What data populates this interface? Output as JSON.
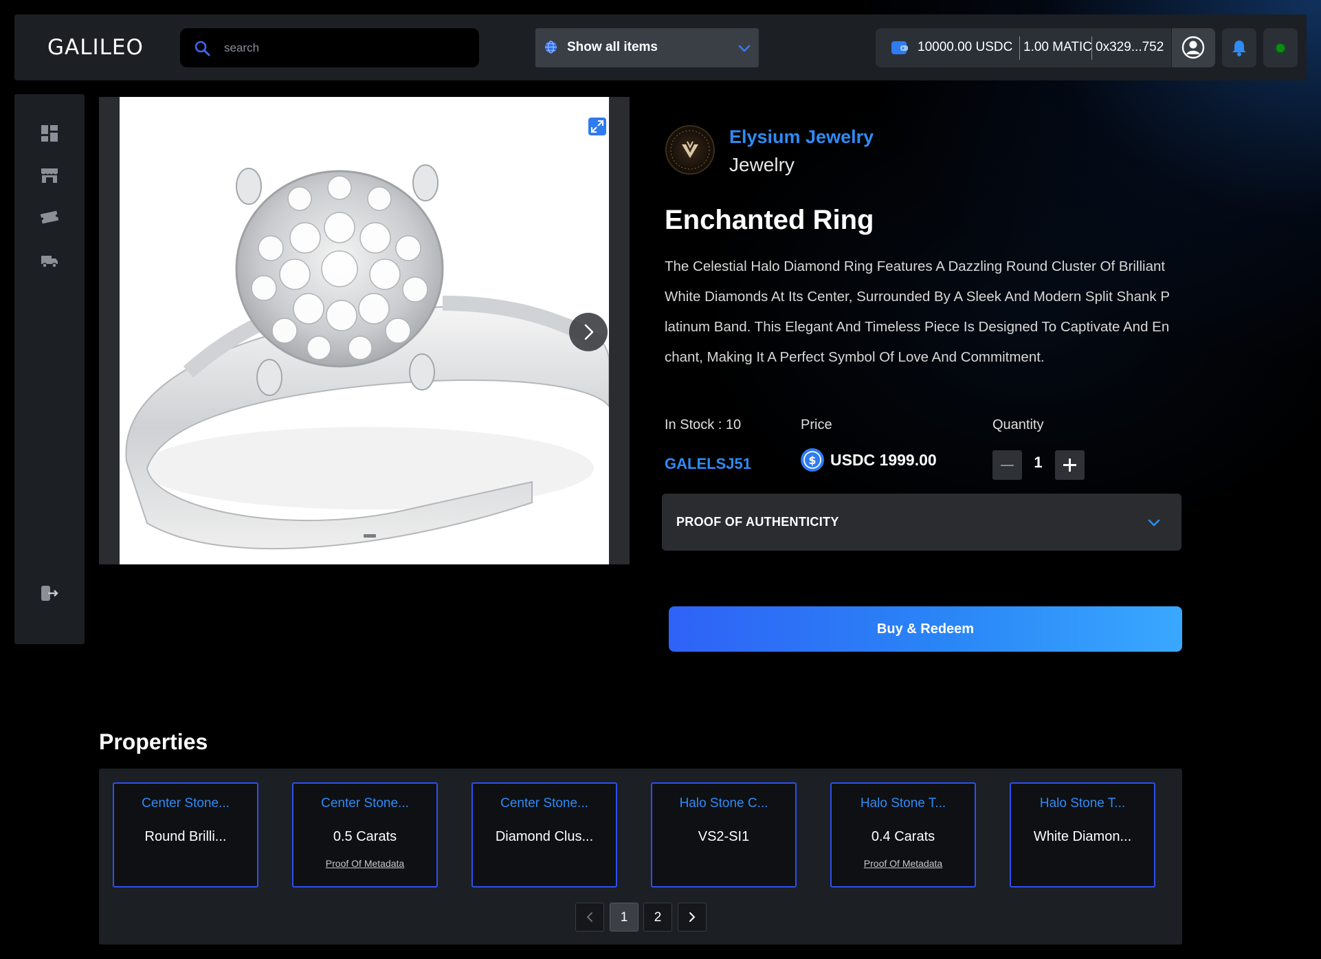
{
  "header": {
    "logo": "GALILEO",
    "search_placeholder": "search",
    "filter_label": "Show all items",
    "wallet": {
      "usdc": "10000.00 USDC",
      "matic": "1.00 MATIC",
      "address": "0x329...752"
    },
    "status_color": "#0f8a1a"
  },
  "sidebar": {
    "items": [
      {
        "icon": "dashboard-icon"
      },
      {
        "icon": "store-icon"
      },
      {
        "icon": "ticket-icon"
      },
      {
        "icon": "truck-icon"
      }
    ],
    "bottom_icon": "logout-icon"
  },
  "gallery": {
    "current_slide": 1
  },
  "product": {
    "brand_name": "Elysium Jewelry",
    "brand_category": "Jewelry",
    "title": "Enchanted Ring",
    "description": "The Celestial Halo Diamond Ring Features A Dazzling Round Cluster Of Brilliant White Diamonds At Its Center, Surrounded By A Sleek And Modern Split Shank Platinum Band. This Elegant And Timeless Piece Is Designed To Captivate And Enchant, Making It A Perfect Symbol Of Love And Commitment.",
    "stock_label": "In Stock : 10",
    "sku": "GALELSJ51",
    "price_label": "Price",
    "price_value": "USDC 1999.00",
    "quantity_label": "Quantity",
    "quantity_value": "1",
    "proof_label": "PROOF OF AUTHENTICITY",
    "buy_label": "Buy & Redeem"
  },
  "properties": {
    "title": "Properties",
    "cards": [
      {
        "key": "Center Stone...",
        "value": "Round Brilli...",
        "meta": ""
      },
      {
        "key": "Center Stone...",
        "value": "0.5 Carats",
        "meta": "Proof Of Metadata"
      },
      {
        "key": "Center Stone...",
        "value": "Diamond Clus...",
        "meta": ""
      },
      {
        "key": "Halo Stone C...",
        "value": "VS2-SI1",
        "meta": ""
      },
      {
        "key": "Halo Stone T...",
        "value": "0.4 Carats",
        "meta": "Proof Of Metadata"
      },
      {
        "key": "Halo Stone T...",
        "value": "White Diamon...",
        "meta": ""
      }
    ],
    "pagination": {
      "pages": [
        "1",
        "2"
      ],
      "current": "1"
    }
  },
  "colors": {
    "accent": "#2f8bf5",
    "card_border": "#2f4ff0",
    "buy_gradient_start": "#2f62f6",
    "buy_gradient_end": "#3aa8ff"
  }
}
